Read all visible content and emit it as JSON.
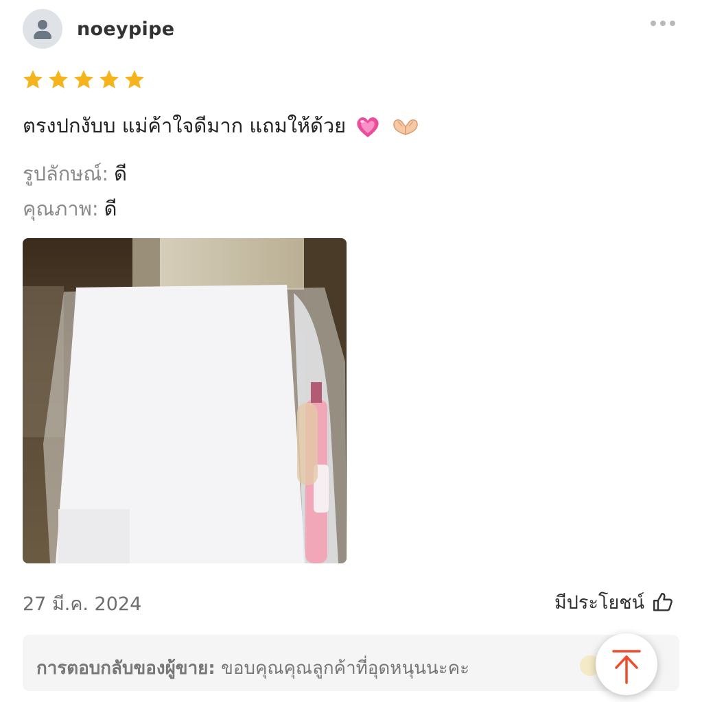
{
  "review": {
    "username": "noeypipe",
    "rating": 5,
    "text": "ตรงปกงับบ แม่ค้าใจดีมาก แถมให้ด้วย",
    "text_emojis": [
      "heart-emoji",
      "hand-heart-emoji"
    ],
    "attributes": [
      {
        "label": "รูปลักษณ์:",
        "value": "ดี"
      },
      {
        "label": "คุณภาพ:",
        "value": "ดี"
      }
    ],
    "date": "27 มี.ค. 2024",
    "helpful_label": "มีประโยชน์"
  },
  "seller_reply": {
    "label": "การตอบกลับของผู้ขาย:",
    "text": "ขอบคุณคุณลูกค้าที่อุดหนุนนะคะ"
  },
  "colors": {
    "star": "#f5b41c",
    "accent": "#ee4d2d",
    "reply_bg": "#f5f5f5"
  },
  "icons": [
    "person-icon",
    "more-icon",
    "star-icon",
    "thumbs-up-icon",
    "arrow-up-icon"
  ]
}
